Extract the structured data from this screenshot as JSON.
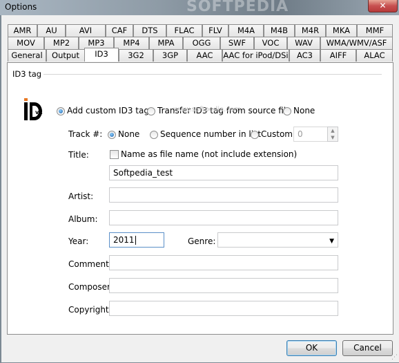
{
  "window": {
    "title": "Options",
    "watermark": "SOFTPEDIA",
    "close_glyph": "✕"
  },
  "tabs": {
    "row1": [
      "AMR",
      "AU",
      "AVI",
      "CAF",
      "DTS",
      "FLAC",
      "FLV",
      "M4A",
      "M4B",
      "M4R",
      "MKA",
      "MMF"
    ],
    "row2": [
      "MOV",
      "MP2",
      "MP3",
      "MP4",
      "MPA",
      "OGG",
      "SWF",
      "VOC",
      "WAV",
      "WMA/WMV/ASF"
    ],
    "row3": [
      "General",
      "Output",
      "ID3",
      "3G2",
      "3GP",
      "AAC",
      "AAC for iPod/DSi",
      "AC3",
      "AIFF",
      "ALAC"
    ],
    "selected": "ID3"
  },
  "id3": {
    "group_title": "ID3 tag",
    "logo_text": "ID3",
    "logo_version": "v2",
    "mode_options": [
      "Add custom ID3 tag",
      "Transfer ID3 tag from source file",
      "None"
    ],
    "mode_selected": "Add custom ID3 tag",
    "center_watermark": "www.softpedia.com",
    "track_label": "Track #:",
    "track_options": [
      "None",
      "Sequence number in list",
      "Custom"
    ],
    "track_selected": "None",
    "track_custom_value": "0",
    "title_label": "Title:",
    "title_checkbox_label": "Name as file name (not include extension)",
    "title_checkbox_checked": false,
    "title_value": "Softpedia_test",
    "artist_label": "Artist:",
    "artist_value": "",
    "album_label": "Album:",
    "album_value": "",
    "year_label": "Year:",
    "year_value": "2011",
    "genre_label": "Genre:",
    "genre_value": "",
    "comment_label": "Comment:",
    "comment_value": "",
    "composer_label": "Composer:",
    "composer_value": "",
    "copyright_label": "Copyright:",
    "copyright_value": ""
  },
  "buttons": {
    "ok": "OK",
    "cancel": "Cancel"
  }
}
